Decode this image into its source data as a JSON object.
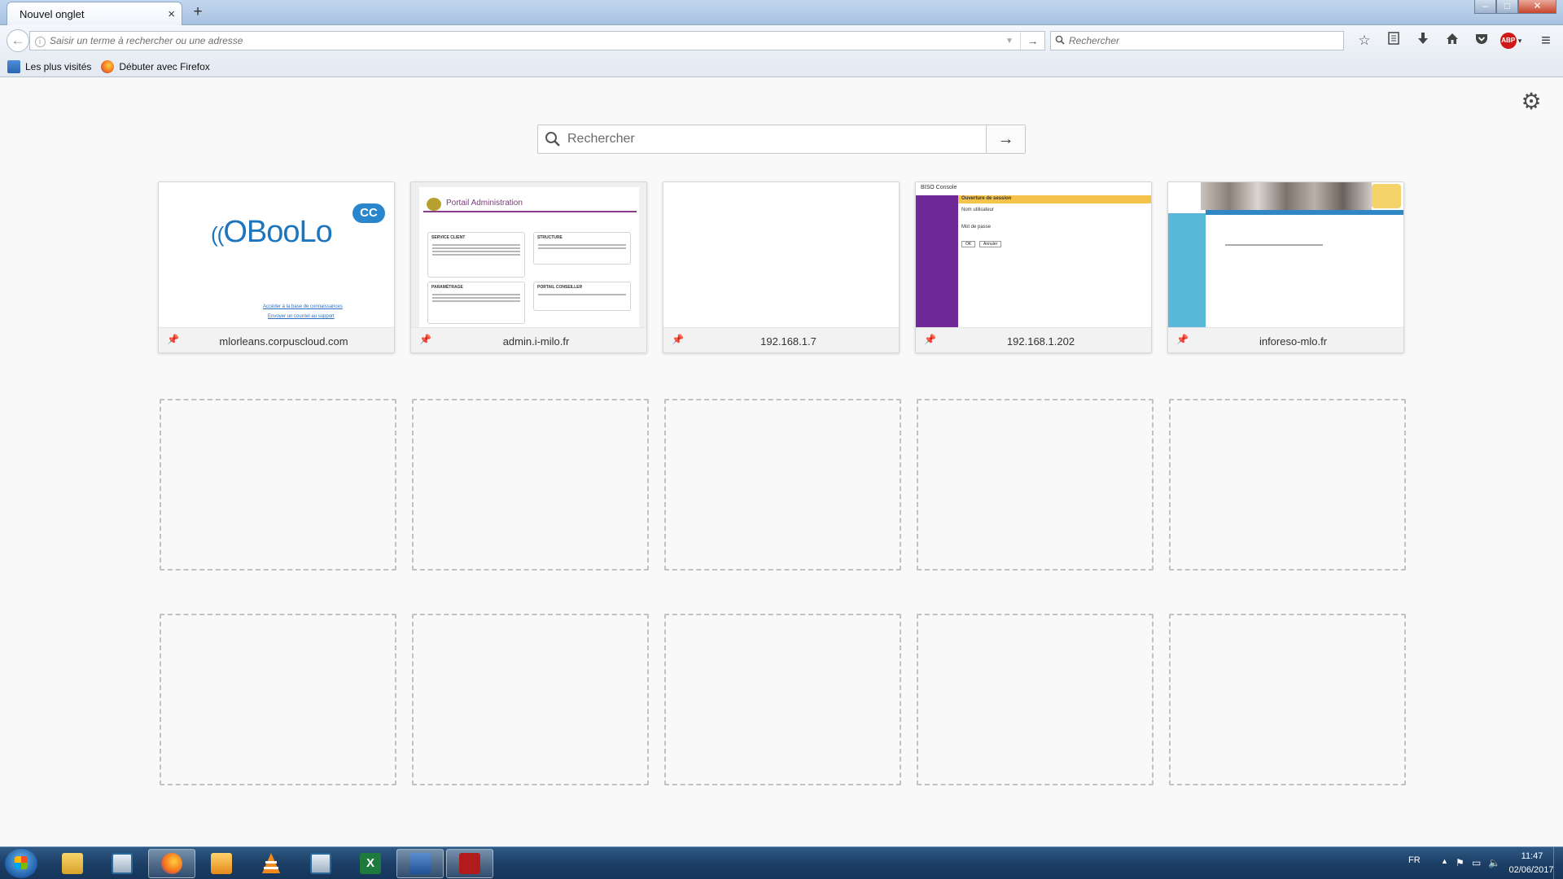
{
  "browser": {
    "tab": {
      "title": "Nouvel onglet",
      "close": "×"
    },
    "new_tab": "+",
    "window_controls": {
      "minimize": "–",
      "maximize": "□",
      "close": "✕"
    }
  },
  "navbar": {
    "back": "←",
    "url_placeholder": "Saisir un terme à rechercher ou une adresse",
    "go": "→",
    "search_placeholder": "Rechercher",
    "icons": [
      "star-icon",
      "reading-list-icon",
      "download-icon",
      "home-icon",
      "pocket-icon",
      "adblock-icon"
    ],
    "adblock_label": "ABP",
    "menu": "≡"
  },
  "bookmarks": [
    {
      "label": "Les plus visités",
      "icon": "folder-icon"
    },
    {
      "label": "Débuter avec Firefox",
      "icon": "firefox-icon"
    }
  ],
  "newtab": {
    "search_placeholder": "Rechercher",
    "go": "→",
    "tiles": [
      {
        "label": "mlorleans.corpuscloud.com",
        "logo": "OBooLo",
        "logo_badge": "CC",
        "links": [
          "Accéder à la base de connaissances",
          "Envoyer un courriel au support"
        ]
      },
      {
        "label": "admin.i-milo.fr",
        "title": "Portail Administration",
        "boxes": [
          "SERVICE CLIENT",
          "STRUCTURE",
          "PARAMÉTRAGE",
          "PORTAIL CONSEILLER"
        ]
      },
      {
        "label": "192.168.1.7"
      },
      {
        "label": "192.168.1.202",
        "header": "BISO Console",
        "login_title": "Ouverture de session",
        "user_label": "Nom utilisateur",
        "password_label": "Mot de passe",
        "ok": "OK",
        "cancel": "Annuler"
      },
      {
        "label": "inforeso-mlo.fr"
      }
    ],
    "empty_tile_count": 10
  },
  "taskbar": {
    "apps": [
      "explorer-icon",
      "firefox-icon",
      "media-player-icon",
      "vlc-icon",
      "window-icon",
      "excel-icon",
      "network-icon",
      "acrobat-icon"
    ],
    "lang": "FR",
    "time": "11:47",
    "date": "02/06/2017"
  },
  "colors": {
    "accent": "#1d76bd",
    "tray_bg": "#1d3f66",
    "biso_purple": "#6f2a98",
    "biso_yellow": "#f6c34a"
  }
}
